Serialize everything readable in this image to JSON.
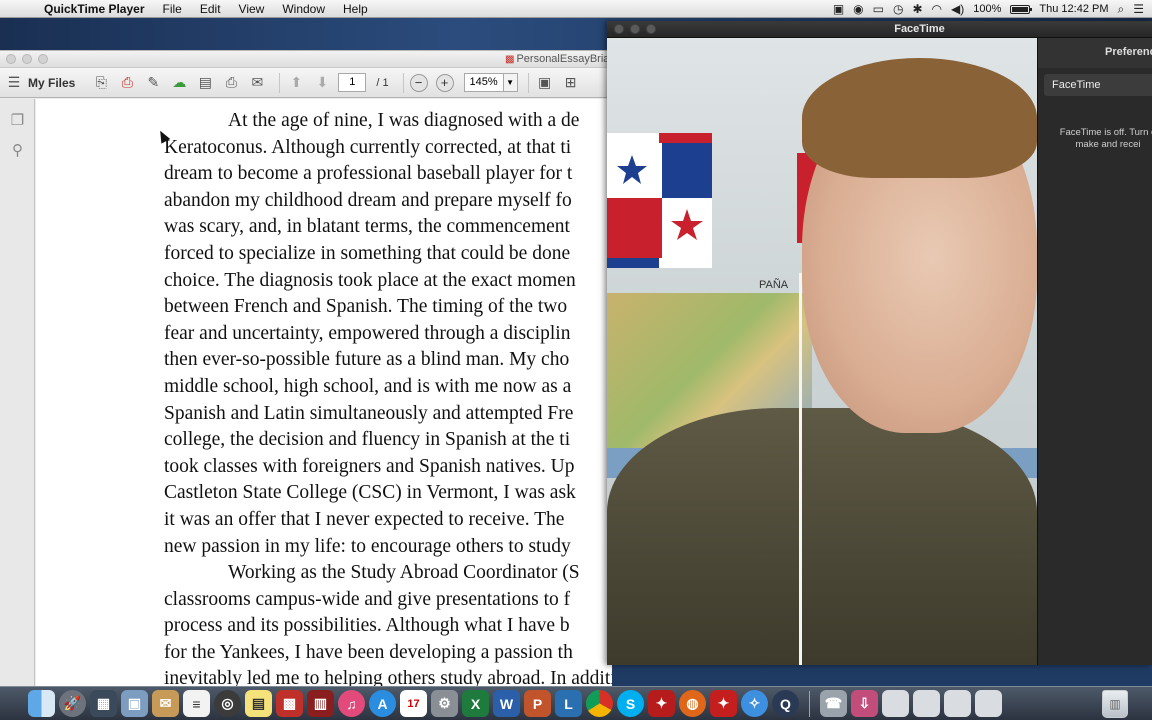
{
  "menubar": {
    "app_name": "QuickTime Player",
    "menus": [
      "File",
      "Edit",
      "View",
      "Window",
      "Help"
    ],
    "battery_percent": "100%",
    "clock": "Thu 12:42 PM"
  },
  "pdf_window": {
    "title": "PersonalEssayBria",
    "toolbar": {
      "my_files_label": "My Files",
      "page_current": "1",
      "page_total": "/ 1",
      "zoom": "145%"
    },
    "essay_lines": [
      "At the age of nine, I was diagnosed with a de",
      "Keratoconus. Although currently corrected, at that ti",
      "dream to become a professional baseball player for t",
      "abandon my childhood dream and prepare myself fo",
      "was scary, and, in blatant terms, the commencement",
      "forced to specialize in something that could be done",
      "choice. The diagnosis took place at the exact momen",
      "between French and Spanish. The timing of the two",
      "fear and uncertainty, empowered through a disciplin",
      "then ever-so-possible future as a blind man. My cho",
      "middle school, high school, and is with me now as a",
      "Spanish and Latin simultaneously and attempted Fre",
      "college, the decision and fluency in Spanish at the ti",
      "took classes with foreigners and Spanish natives. Up",
      "Castleton State College (CSC) in Vermont, I was ask",
      "it was an offer that I never expected to receive.  The",
      "new passion in my life: to encourage others to study",
      "Working as the Study Abroad Coordinator (S",
      "classrooms campus-wide and give presentations to f",
      "process and its possibilities. Although what I have b",
      "for the Yankees, I have been developing a passion th",
      "inevitably led me to helping others study abroad. In addition to my position as the SAC, I have"
    ]
  },
  "facetime_window": {
    "title": "FaceTime",
    "panel_header": "Preferences",
    "panel_tab": "FaceTime",
    "status_text_line1": "FaceTime is off. Turn o",
    "status_text_line2": "make and recei",
    "wall_map_label": "PAÑA"
  },
  "dock": {
    "icons": [
      "finder-icon",
      "launchpad-icon",
      "mission-control-icon",
      "preview-icon",
      "folder-icon",
      "textedit-icon",
      "screenshot-icon",
      "notes-icon",
      "pdf-icon",
      "photo-booth-icon",
      "itunes-icon",
      "app-store-icon",
      "calendar-icon",
      "settings-icon",
      "excel-icon",
      "word-icon",
      "powerpoint-icon",
      "lync-icon",
      "chrome-icon",
      "skype-icon",
      "acrobat-icon",
      "firefox-icon",
      "acrobat-reader-icon",
      "safari-icon",
      "quicktime-icon",
      "facetime-icon",
      "downloads-icon",
      "window-1-icon",
      "window-2-icon",
      "window-3-icon",
      "window-4-icon"
    ],
    "calendar_day": "17"
  },
  "colors": {
    "menubar": "#e6e6e6",
    "desktop": "#1f3a63",
    "pdf_page": "#ffffff",
    "facetime_chrome": "#2a2a2a"
  }
}
